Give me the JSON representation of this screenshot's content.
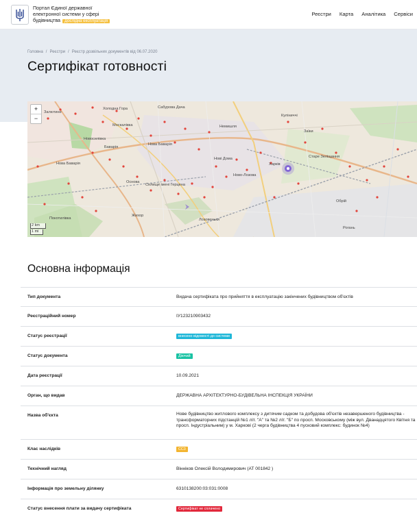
{
  "header": {
    "brand_line1": "Портал Єдиної державної",
    "brand_line2": "електронної системи у сфері",
    "brand_line3": "будівництва",
    "brand_badge": "Дослідна експлуатація",
    "nav": [
      "Реєстри",
      "Карта",
      "Аналітика",
      "Сервіси"
    ]
  },
  "breadcrumb": [
    "Головна",
    "Реєстри",
    "Реєстр дозвільних документів від 06.07.2020"
  ],
  "page_title": "Сертифікат готовності",
  "map": {
    "zoom_in": "+",
    "zoom_out": "−",
    "scale_km": "2 km",
    "scale_mi": "1 mi",
    "places": [
      "Залютине",
      "Холодна Гора",
      "Сабурова Дача",
      "Немишля",
      "Куліниччі",
      "Заїки",
      "Москалівка",
      "Новоселівка",
      "Баварія",
      "Жихор",
      "Покотилівка",
      "Нова Баварія",
      "Основа",
      "Селище імені Герцена",
      "Лозовеньки",
      "Старе Зеліщання",
      "Рогань",
      "Обрій",
      "Ново-Лозова",
      "Нові Дома",
      "Нова Баварія",
      "Харків"
    ]
  },
  "section_title": "Основна інформація",
  "fields": [
    {
      "key": "Тип документа",
      "value": "Видача сертифіката про прийняття в експлуатацію закінчених будівництвом об'єктів"
    },
    {
      "key": "Реєстраційний номер",
      "value": "ІУ123210903432"
    },
    {
      "key": "Статус реєстрації",
      "value": "внесено відомості до системи",
      "tag_color": "#1fb7d8"
    },
    {
      "key": "Статус документа",
      "value": "Діючий",
      "tag_color": "#19c2a3"
    },
    {
      "key": "Дата реєстрації",
      "value": "10.09.2021"
    },
    {
      "key": "Орган, що видав",
      "value": "ДЕРЖАВНА АРХІТЕКТУРНО-БУДІВЕЛЬНА ІНСПЕКЦІЯ УКРАЇНИ"
    },
    {
      "key": "Назва об'єкта",
      "value": "Нове будівництво житлового комплексу з дитячим садком та добудова об'єктів незавершеного будівництва - трансформаторних підстанцій №1 літ. \"А\" та №2 літ. \"Б\" по просп. Московському (між вул. Дванадцятого Квітня та просп. Індустріальним) у м. Харкові (2 черга будівництва 4 пусковий комплекс: будинок №4)"
    },
    {
      "key": "Клас наслідків",
      "value": "СС3",
      "tag_color": "#f3b531"
    },
    {
      "key": "Технічний нагляд",
      "value": "Вінніков Олексій Володимирович (АТ 001842 )"
    },
    {
      "key": "Інформація про земельну ділянку",
      "value": "6310138200:03:031:0008"
    },
    {
      "key": "Статус внесення плати за видачу сертифіката",
      "value": "Сертифікат не сплачено",
      "tag_color": "#e2283b"
    }
  ]
}
